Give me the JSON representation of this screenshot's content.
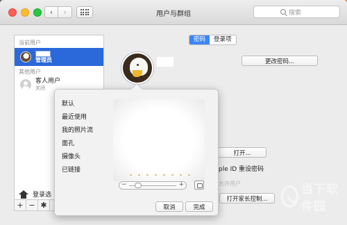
{
  "window": {
    "title": "用户与群组"
  },
  "search": {
    "placeholder": "搜索"
  },
  "sidebar": {
    "current_users_label": "当前用户",
    "admin_role": "管理员",
    "other_users_label": "其他用户",
    "guest_name": "客人用户",
    "guest_status": "关闭",
    "login_options": "登录选"
  },
  "tabs": [
    {
      "label": "密码",
      "active": true
    },
    {
      "label": "登录项",
      "active": false
    }
  ],
  "main": {
    "change_password": "更改密码...",
    "open": "打开...",
    "apple_id_reset": "ple ID 重设密码",
    "allow_admin": "允许用户",
    "parental_controls": "打开家长控制..."
  },
  "popover": {
    "menu": [
      "默认",
      "最近使用",
      "我的照片流",
      "面孔",
      "摄像头",
      "已链接"
    ],
    "cancel": "取消",
    "done": "完成"
  },
  "watermark": {
    "text": "当下软件园"
  }
}
